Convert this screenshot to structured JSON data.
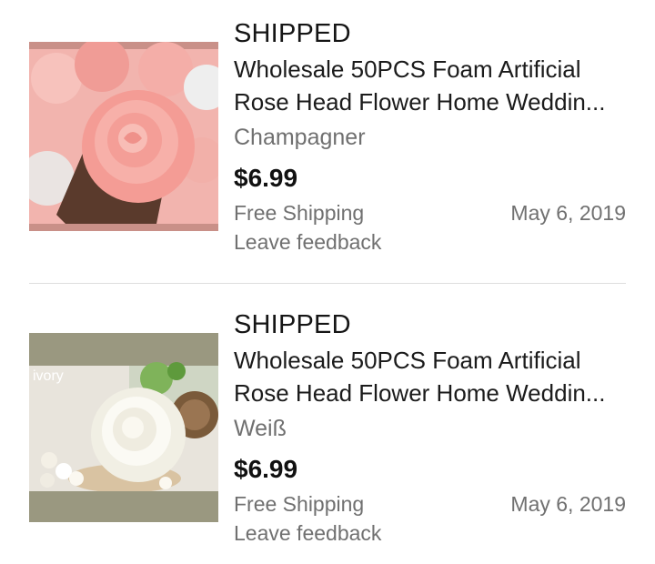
{
  "orders": [
    {
      "status": "SHIPPED",
      "title": "Wholesale 50PCS Foam Artificial Rose Head Flower Home Weddin...",
      "variant": "Champagner",
      "price": "$6.99",
      "shipping": "Free Shipping",
      "date": "May 6, 2019",
      "feedback": "Leave feedback",
      "thumb_label": ""
    },
    {
      "status": "SHIPPED",
      "title": "Wholesale 50PCS Foam Artificial Rose Head Flower Home Weddin...",
      "variant": "Weiß",
      "price": "$6.99",
      "shipping": "Free Shipping",
      "date": "May 6, 2019",
      "feedback": "Leave feedback",
      "thumb_label": "ivory"
    }
  ],
  "colors": {
    "pink_rose": "#f4a4a0",
    "pink_frame": "#c99088",
    "ivory_frame": "#9a9880",
    "ivory_rose": "#f6f4ec"
  }
}
